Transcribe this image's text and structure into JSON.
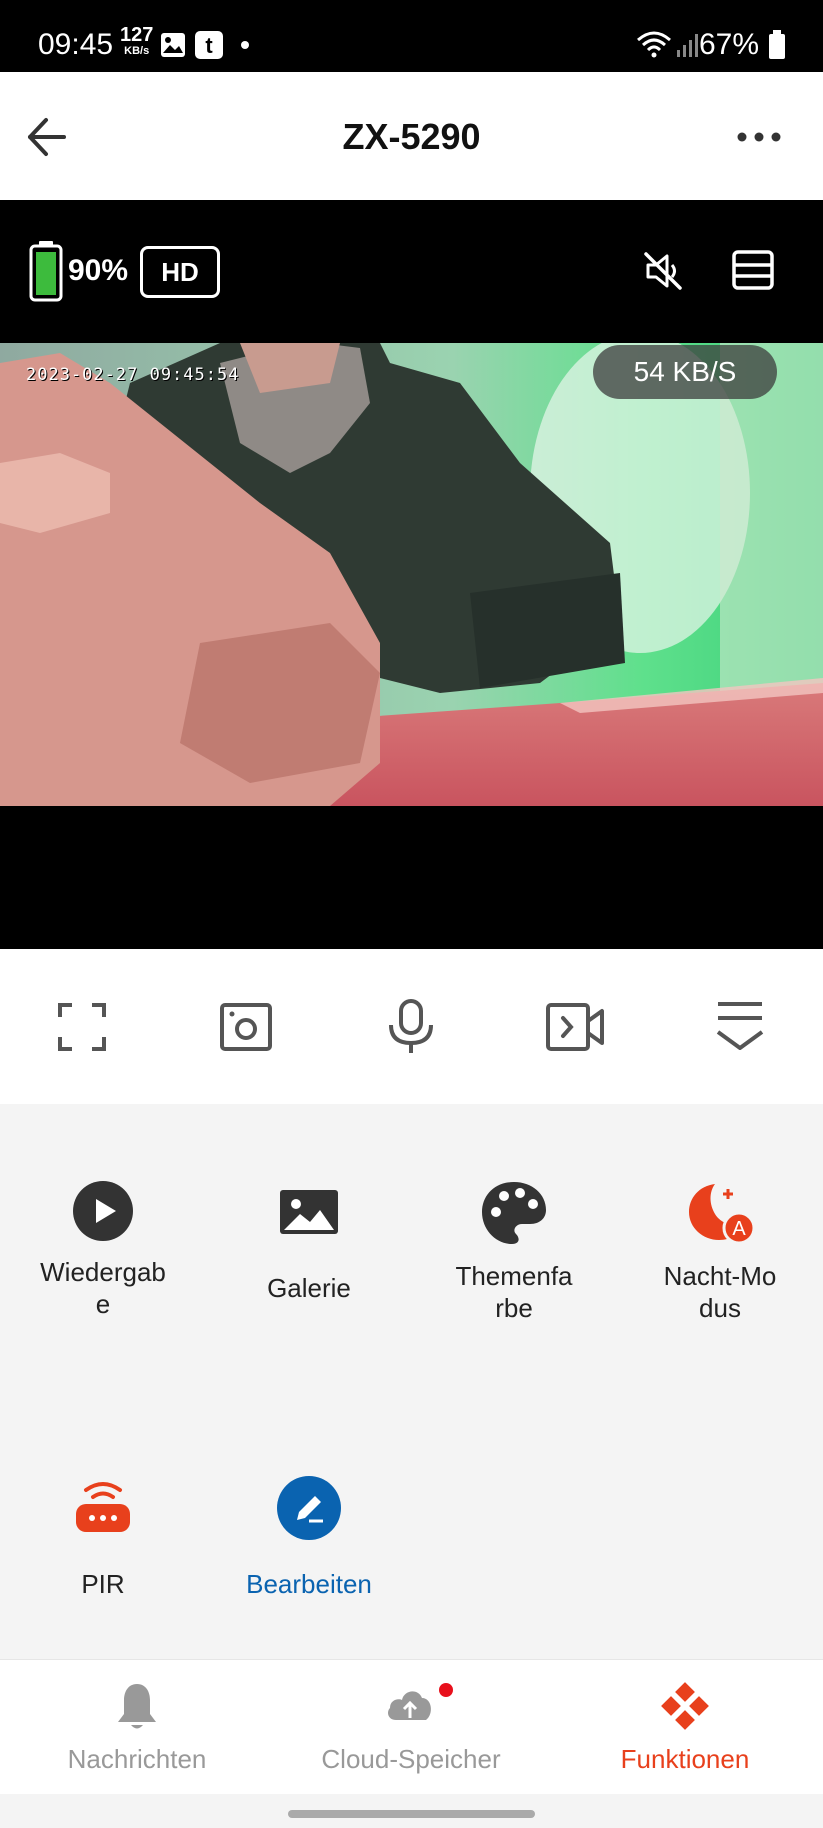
{
  "status_bar": {
    "time": "09:45",
    "net_speed_value": "127",
    "net_speed_unit": "KB/s",
    "battery_percent": "67%"
  },
  "header": {
    "title": "ZX-5290"
  },
  "video_bar": {
    "battery": "90%",
    "quality": "HD"
  },
  "video": {
    "timestamp": "2023-02-27 09:45:54",
    "bitrate": "54 KB/S"
  },
  "features": [
    {
      "label": "Wiedergab\ne",
      "icon": "play-circle-icon"
    },
    {
      "label": "Galerie",
      "icon": "image-icon"
    },
    {
      "label": "Themenfa\nrbe",
      "icon": "palette-icon"
    },
    {
      "label": "Nacht-Mo\ndus",
      "icon": "night-mode-icon"
    },
    {
      "label": "PIR",
      "icon": "pir-sensor-icon"
    },
    {
      "label": "Bearbeiten",
      "icon": "edit-icon"
    }
  ],
  "bottom_nav": [
    {
      "label": "Nachrichten",
      "icon": "bell-icon"
    },
    {
      "label": "Cloud-Speicher",
      "icon": "cloud-upload-icon"
    },
    {
      "label": "Funktionen",
      "icon": "functions-icon"
    }
  ],
  "colors": {
    "accent_red": "#e8401c",
    "accent_blue": "#0a63b0",
    "battery_green": "#3dbb3d"
  }
}
